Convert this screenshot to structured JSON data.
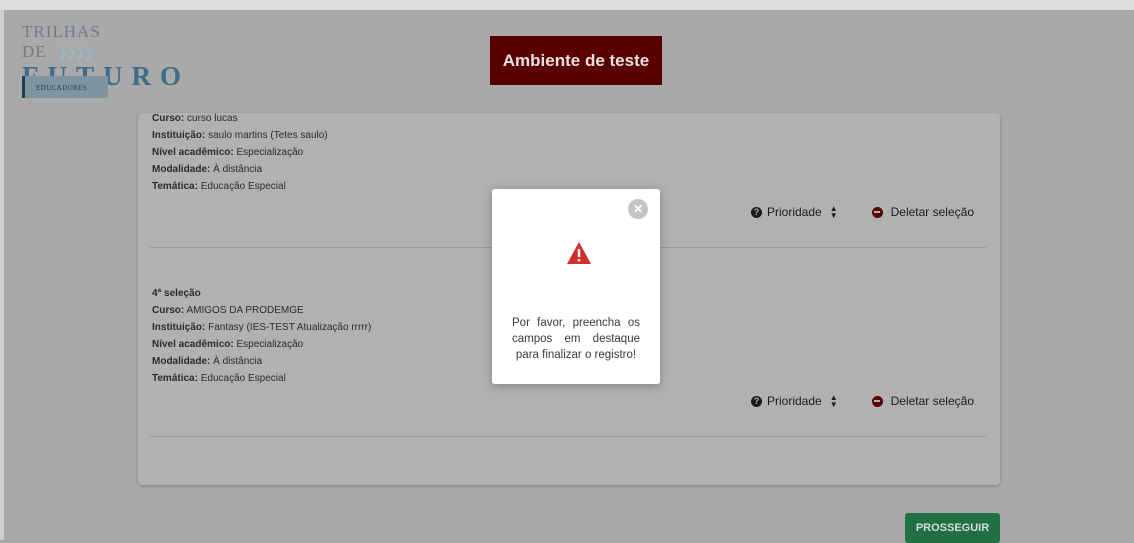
{
  "logo": {
    "line1": "TRILHAS DE",
    "arrows": "❯❯❯❯",
    "line2": "FUTURO",
    "badge": "EDUCADORES"
  },
  "environment_banner": "Ambiente de teste",
  "selections": [
    {
      "title": "",
      "curso_label": "Curso:",
      "curso": "curso lucas",
      "instituicao_label": "Instituição:",
      "instituicao": "saulo martins (Tetes saulo)",
      "nivel_label": "Nível acadêmico:",
      "nivel": "Especialização",
      "modalidade_label": "Modalidade:",
      "modalidade": "À distância",
      "tematica_label": "Temática:",
      "tematica": "Educação Especial"
    },
    {
      "title": "4ª seleção",
      "curso_label": "Curso:",
      "curso": "AMIGOS DA PRODEMGE",
      "instituicao_label": "Instituição:",
      "instituicao": "Fantasy (IES-TEST Atualização rrrrr)",
      "nivel_label": "Nível acadêmico:",
      "nivel": "Especialização",
      "modalidade_label": "Modalidade:",
      "modalidade": "À distância",
      "tematica_label": "Temática:",
      "tematica": "Educação Especial"
    }
  ],
  "actions": {
    "priority_label": "Prioridade",
    "delete_label": "Deletar seleção"
  },
  "proceed_button": "PROSSEGUIR",
  "modal": {
    "close": "✕",
    "message": "Por favor, preencha os campos em destaque para finalizar o registro!"
  },
  "colors": {
    "banner": "#8b0000",
    "proceed": "#2e9e5f",
    "warning": "#d32f2f",
    "delete_icon": "#8b0000"
  },
  "icons": {
    "help": "question-circle-icon",
    "sort": "sort-icon",
    "delete": "minus-circle-icon",
    "warning": "warning-triangle-icon",
    "close": "close-icon"
  }
}
